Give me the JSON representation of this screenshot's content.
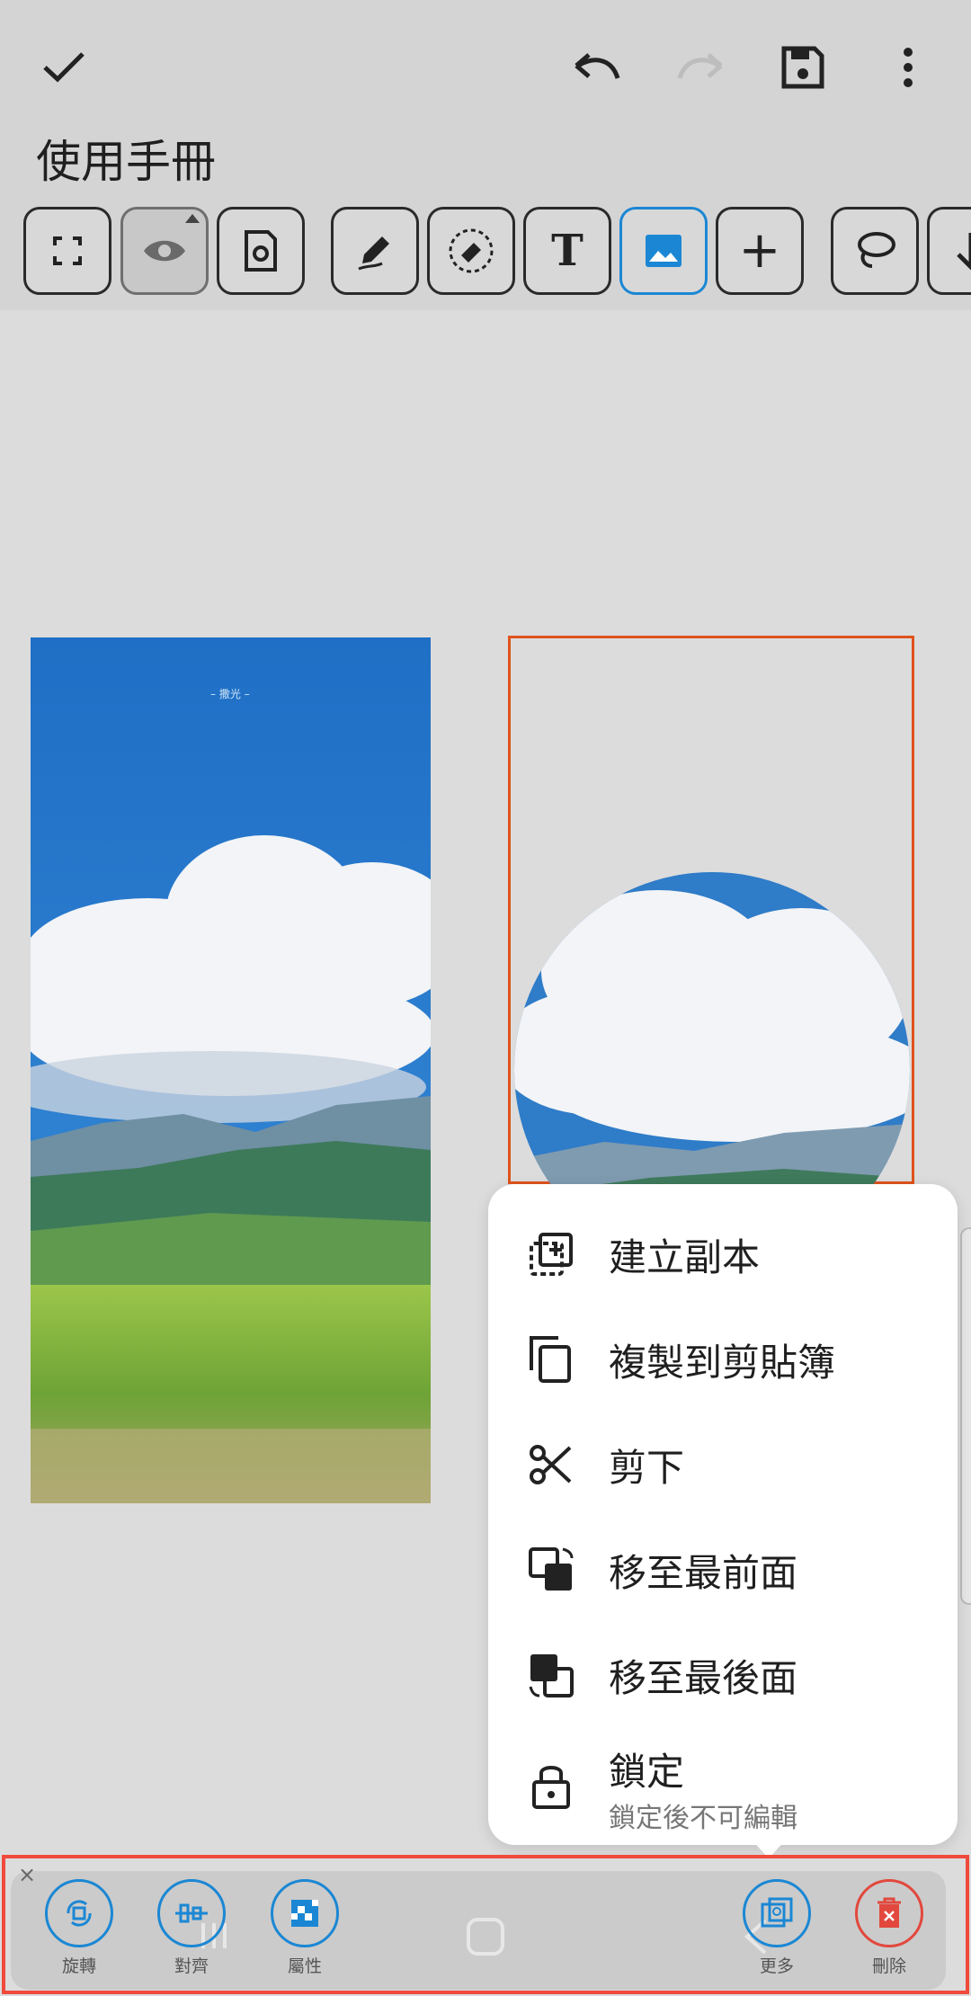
{
  "header": {
    "title": "使用手冊",
    "icons": [
      "check-icon",
      "undo-icon",
      "redo-icon",
      "save-icon",
      "more-vert-icon"
    ]
  },
  "toolbar": {
    "tools": [
      "fullscreen-icon",
      "eye-icon",
      "settings-doc-icon",
      "pen-icon",
      "eraser-icon",
      "text-icon",
      "image-icon",
      "add-icon",
      "lasso-icon",
      "arrow-down-icon"
    ],
    "text_tool_glyph": "T",
    "add_tool_glyph": "+"
  },
  "canvas": {
    "left_image_caption": "– 撒光 –"
  },
  "context_menu": {
    "items": [
      {
        "label": "建立副本",
        "icon": "duplicate-icon"
      },
      {
        "label": "複製到剪貼簿",
        "icon": "copy-icon"
      },
      {
        "label": "剪下",
        "icon": "scissors-icon"
      },
      {
        "label": "移至最前面",
        "icon": "bring-to-front-icon"
      },
      {
        "label": "移至最後面",
        "icon": "send-to-back-icon"
      },
      {
        "label": "鎖定",
        "icon": "lock-icon",
        "sub": "鎖定後不可編輯"
      }
    ]
  },
  "bottom_bar": {
    "close_glyph": "×",
    "buttons": [
      {
        "label": "旋轉",
        "icon": "rotate-icon"
      },
      {
        "label": "對齊",
        "icon": "align-icon"
      },
      {
        "label": "屬性",
        "icon": "properties-icon"
      },
      {
        "label": "更多",
        "icon": "more-icon"
      },
      {
        "label": "刪除",
        "icon": "delete-icon"
      }
    ]
  },
  "colors": {
    "accent": "#1b87d4",
    "selection": "#e0531d",
    "highlight": "#f04a3c",
    "delete": "#e2483d"
  }
}
